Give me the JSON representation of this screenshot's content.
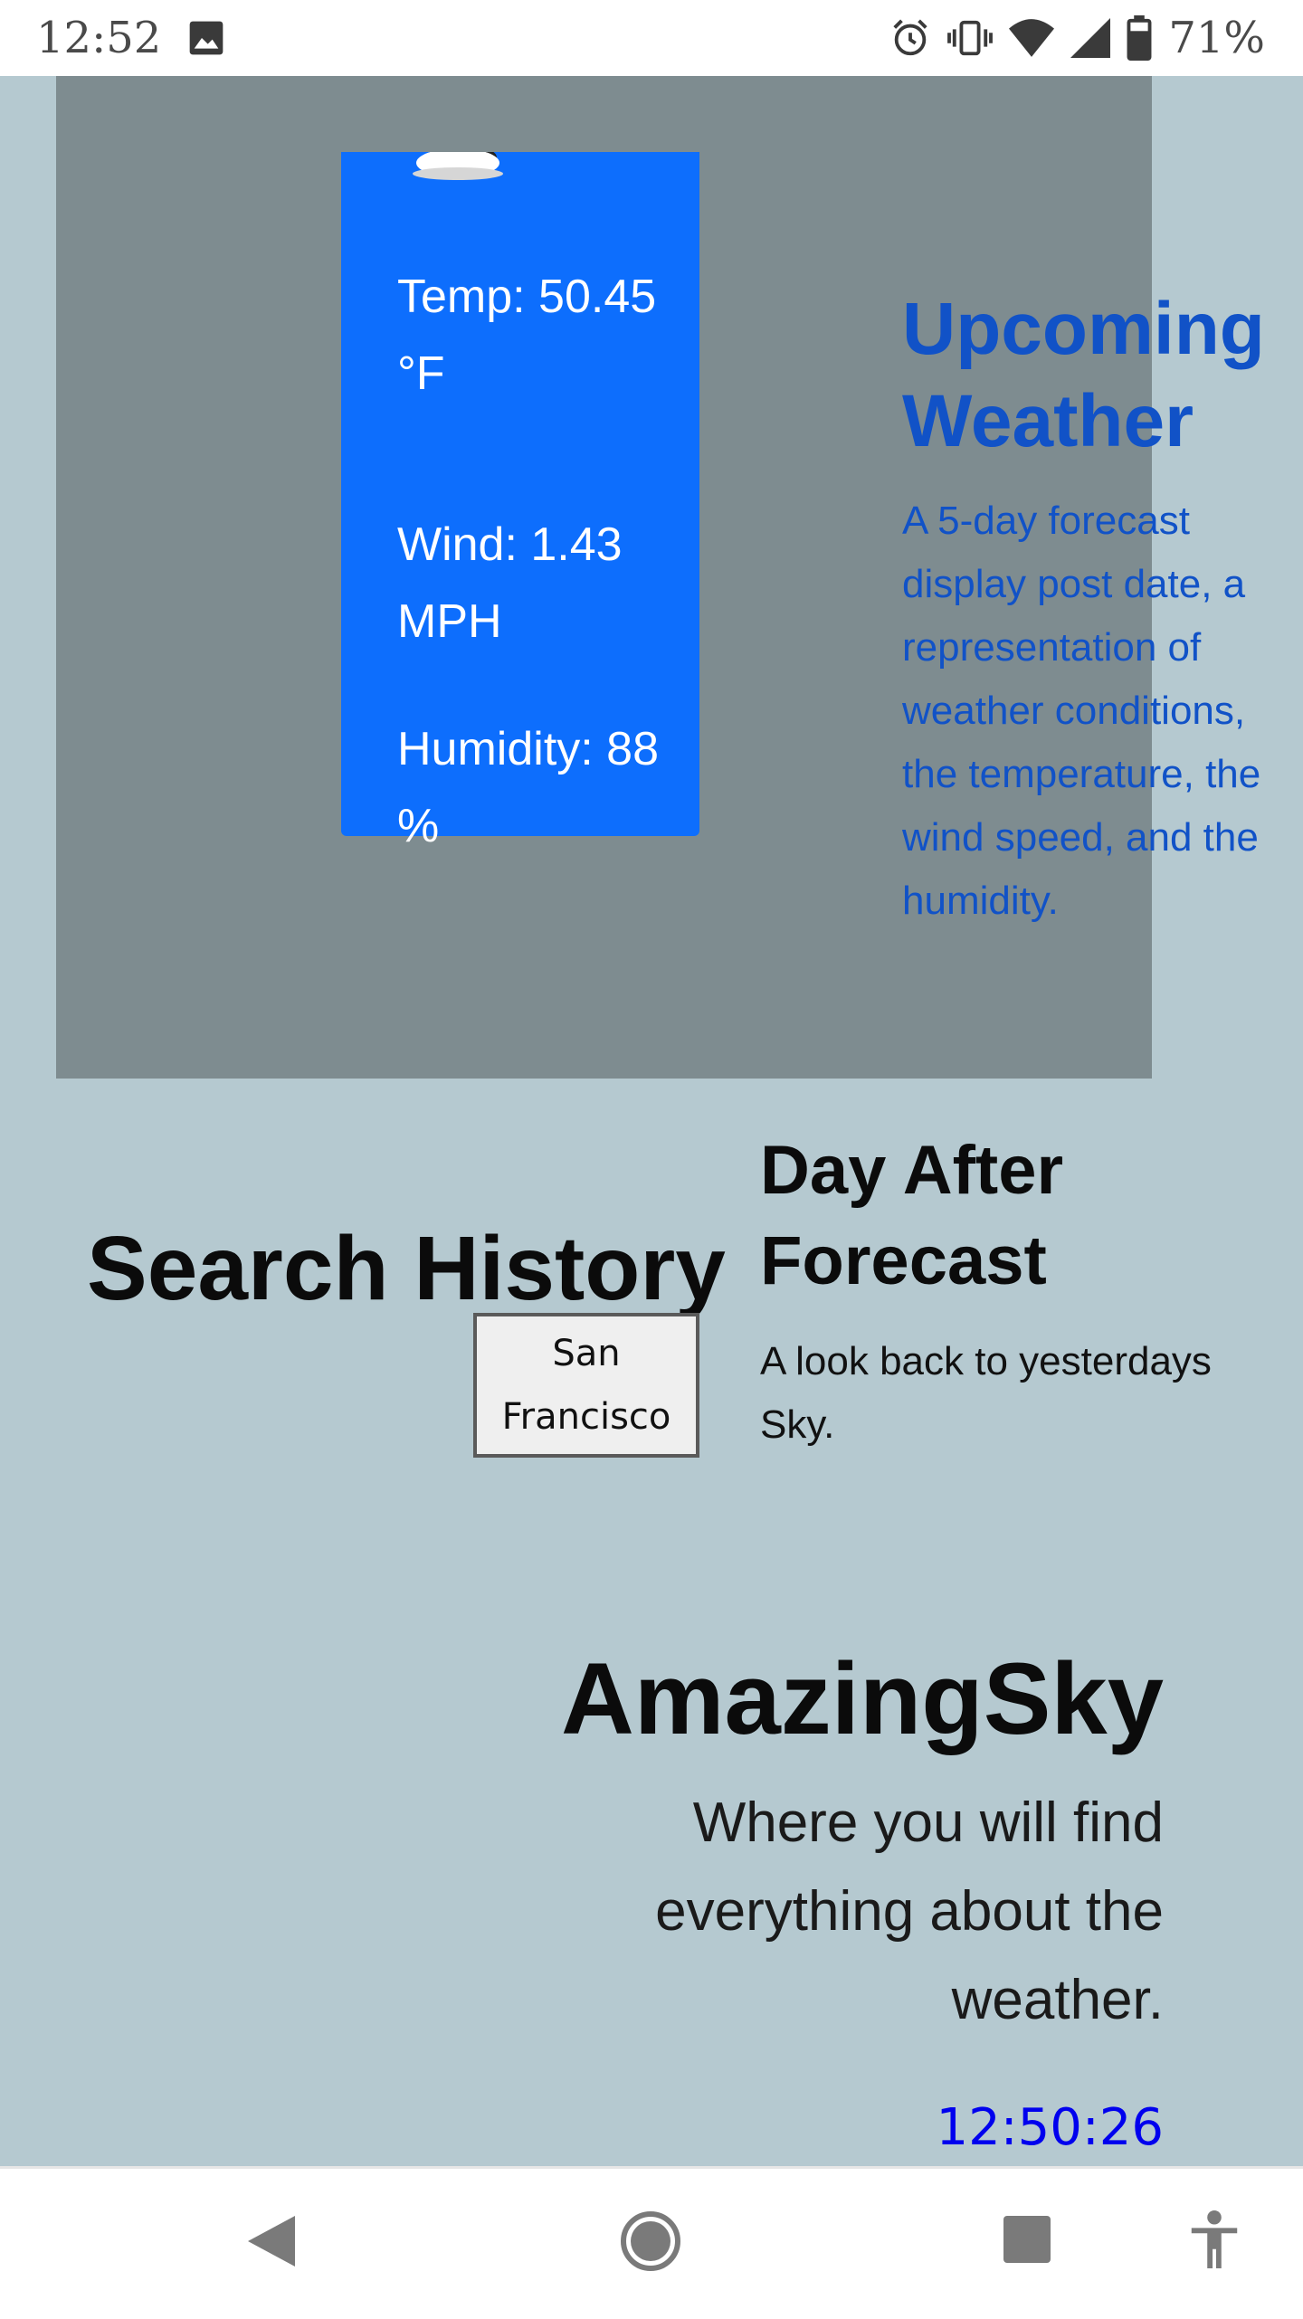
{
  "status_bar": {
    "time": "12:52",
    "battery_percent": "71%",
    "icons": [
      "image-icon",
      "alarm-icon",
      "vibrate-icon",
      "wifi-icon",
      "signal-icon",
      "battery-icon"
    ]
  },
  "forecast_card": {
    "icon": "cloud-icon",
    "temp": "Temp: 50.45 °F",
    "wind": "Wind: 1.43 MPH",
    "humidity": "Humidity: 88 %"
  },
  "upcoming": {
    "title": "Upcoming Weather",
    "description": "A 5-day forecast display post date, a representation of weather conditions, the temperature, the wind speed, and the humidity."
  },
  "search_history": {
    "title": "Search History",
    "cities": [
      "San Francisco"
    ]
  },
  "day_after": {
    "title": "Day After Forecast",
    "description": "A look back to yesterdays Sky."
  },
  "hero": {
    "brand": "AmazingSky",
    "tagline": "Where you will find everything about the weather.",
    "clock": "12:50:26"
  },
  "nav_bar": {
    "icons": [
      "back-icon",
      "home-icon",
      "recents-icon",
      "accessibility-icon"
    ]
  },
  "colors": {
    "page_background": "#b5c9d0",
    "panel": "#7e8c90",
    "card": "#0d6efd",
    "accent_text": "#1152c7",
    "clock": "#0000ee"
  }
}
